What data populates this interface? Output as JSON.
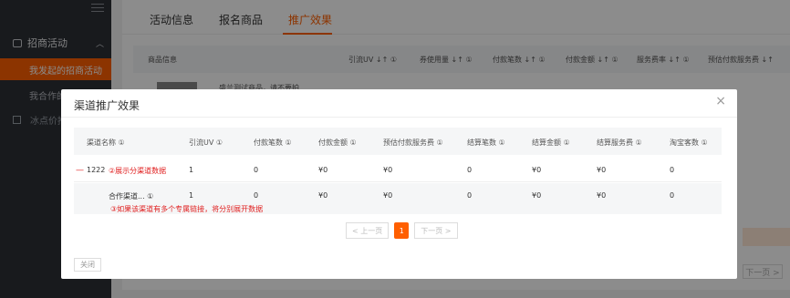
{
  "sidebar": {
    "group_label": "招商活动",
    "active_item": "我发起的招商活动",
    "item2": "我合作的",
    "item3": "冰点价推"
  },
  "background": {
    "tabs": [
      "活动信息",
      "报名商品",
      "推广效果"
    ],
    "table_headers": [
      "商品信息",
      "引流UV ↓↑ ①",
      "券使用量 ↓↑ ①",
      "付款笔数 ↓↑ ①",
      "付款金额 ↓↑ ①",
      "服务费率 ↓↑ ①",
      "预估付款服务费 ↓↑"
    ],
    "row_product_text": "盛兰测试商品，请不要拍",
    "pager_next": "下一页 >"
  },
  "modal": {
    "title": "渠道推广效果",
    "close_label": "×",
    "headers": [
      "渠道名称 ①",
      "引流UV ①",
      "付款笔数 ①",
      "付款金额 ①",
      "预估付款服务费 ①",
      "结算笔数 ①",
      "结算金额 ①",
      "结算服务费 ①",
      "淘宝客数 ①"
    ],
    "row1": {
      "expand": "—",
      "name": "1222",
      "annotation": "②展示分渠道数据",
      "values": [
        "1",
        "0",
        "¥0",
        "¥0",
        "0",
        "¥0",
        "¥0",
        "0"
      ]
    },
    "row2": {
      "name": "合作渠道... ①",
      "annotation": "③如果该渠道有多个专属链接，将分别展开数据",
      "values": [
        "1",
        "0",
        "¥0",
        "¥0",
        "0",
        "¥0",
        "¥0",
        "0"
      ]
    },
    "pager": {
      "prev": "< 上一页",
      "current": "1",
      "next": "下一页 >"
    },
    "footer_close": "关闭"
  },
  "colors": {
    "accent": "#ff5f00",
    "annotation": "#e02020",
    "sidebar": "#2d3036"
  }
}
